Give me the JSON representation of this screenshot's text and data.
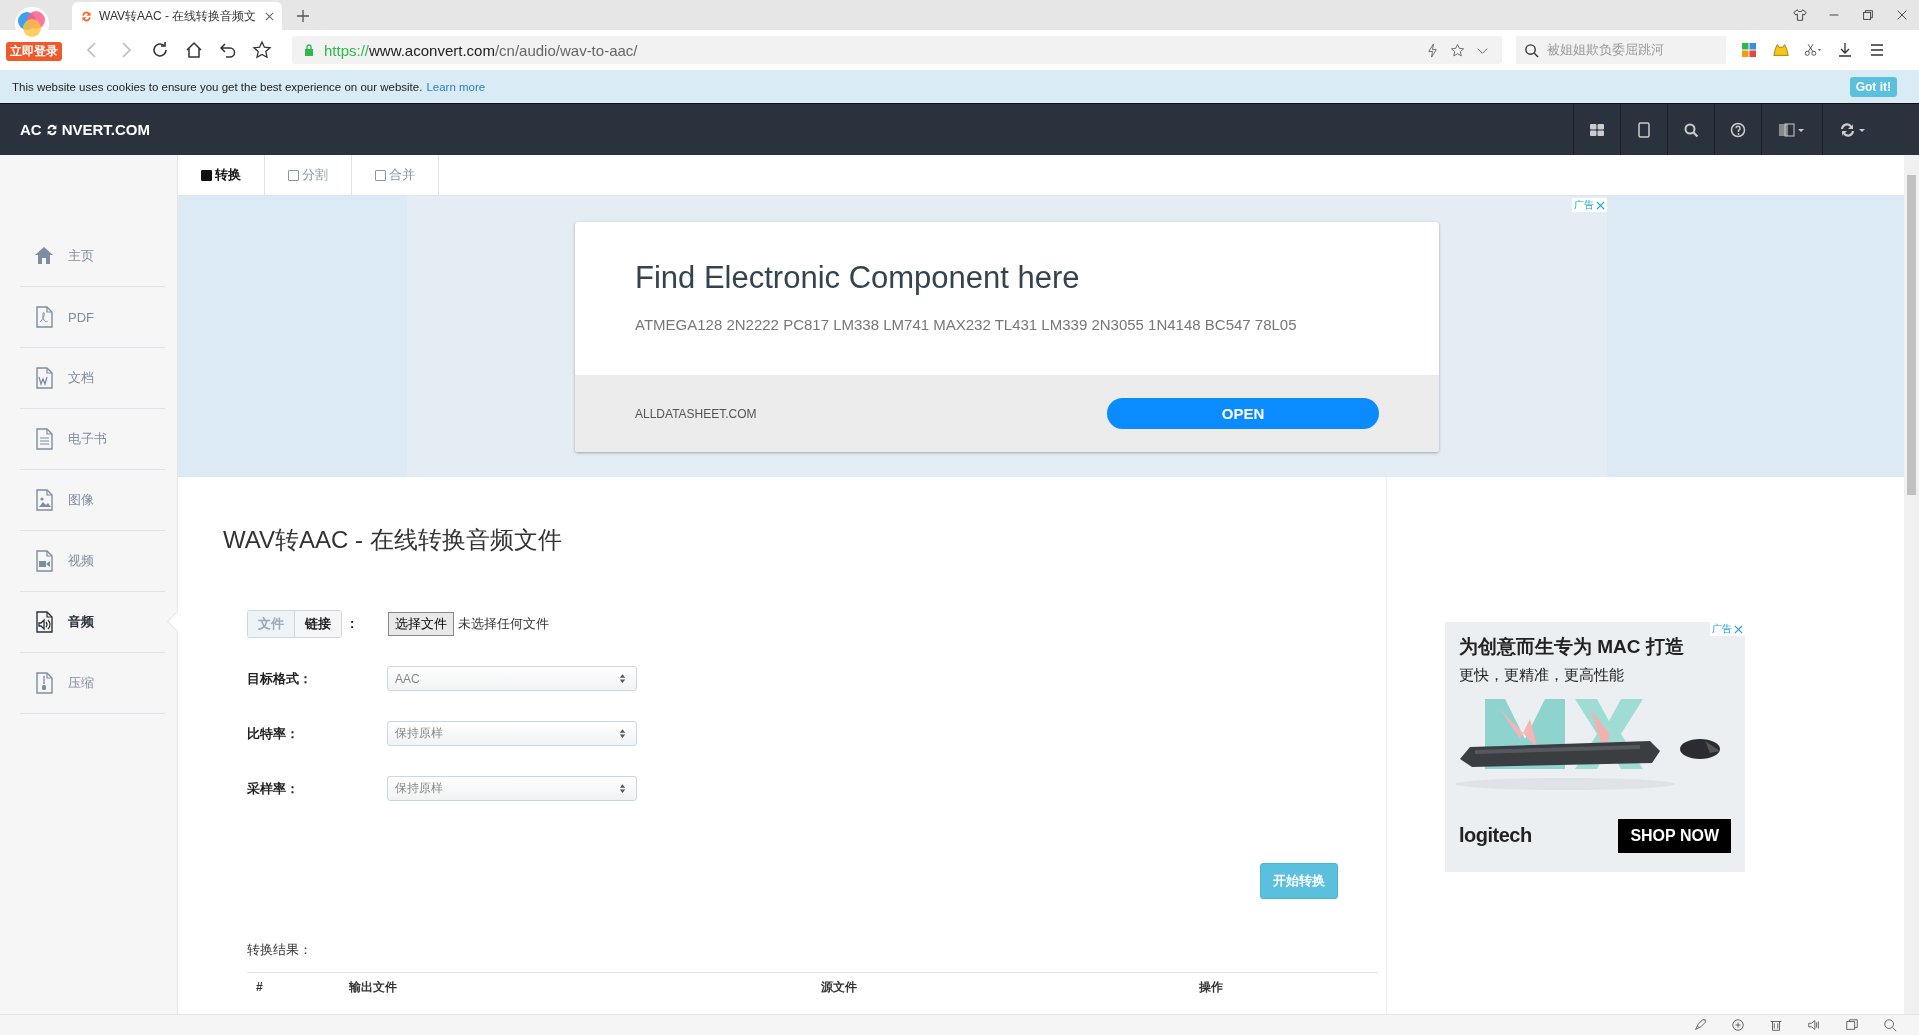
{
  "browser": {
    "login_badge": "立即登录",
    "tab": {
      "title": "WAV转AAC - 在线转换音频文"
    },
    "url": {
      "scheme": "https://",
      "host": "www.aconvert.com",
      "path": "/cn/audio/wav-to-aac/"
    },
    "search": {
      "placeholder": "被姐姐欺负委屈跳河"
    }
  },
  "cookie_bar": {
    "text": "This website uses cookies to ensure you get the best experience on our website.",
    "link": "Learn more",
    "button": "Got it!"
  },
  "site": {
    "logo_left": "AC",
    "logo_right": "NVERT.COM"
  },
  "sidebar": {
    "items": [
      {
        "label": "主页",
        "selected": false
      },
      {
        "label": "PDF",
        "selected": false
      },
      {
        "label": "文档",
        "selected": false
      },
      {
        "label": "电子书",
        "selected": false
      },
      {
        "label": "图像",
        "selected": false
      },
      {
        "label": "视频",
        "selected": false
      },
      {
        "label": "音频",
        "selected": true
      },
      {
        "label": "压缩",
        "selected": false
      }
    ]
  },
  "tabs": [
    {
      "label": "转换",
      "selected": true
    },
    {
      "label": "分割",
      "selected": false
    },
    {
      "label": "合并",
      "selected": false
    }
  ],
  "top_ad": {
    "badge": "广告",
    "title": "Find Electronic Component here",
    "text": "ATMEGA128 2N2222 PC817 LM338 LM741 MAX232 TL431 LM339 2N3055 1N4148 BC547 78L05",
    "source": "ALLDATASHEET.COM",
    "button": "OPEN"
  },
  "page_title": "WAV转AAC - 在线转换音频文件",
  "source_toggle": {
    "options": [
      {
        "label": "文件",
        "selected": true
      },
      {
        "label": "链接",
        "selected": false
      }
    ],
    "separator": ":"
  },
  "file_input": {
    "button": "选择文件",
    "status": "未选择任何文件"
  },
  "fields": [
    {
      "label": "目标格式：",
      "value": "AAC"
    },
    {
      "label": "比特率：",
      "value": "保持原样"
    },
    {
      "label": "采样率：",
      "value": "保持原样"
    }
  ],
  "start_button": "开始转换",
  "results": {
    "label": "转换结果：",
    "columns": [
      "#",
      "输出文件",
      "源文件",
      "操作"
    ]
  },
  "side_ad": {
    "badge": "广告",
    "headline": "为创意而生专为 MAC 打造",
    "subline": "更快，更精准，更高性能",
    "brand": "logitech",
    "button": "SHOP NOW"
  }
}
